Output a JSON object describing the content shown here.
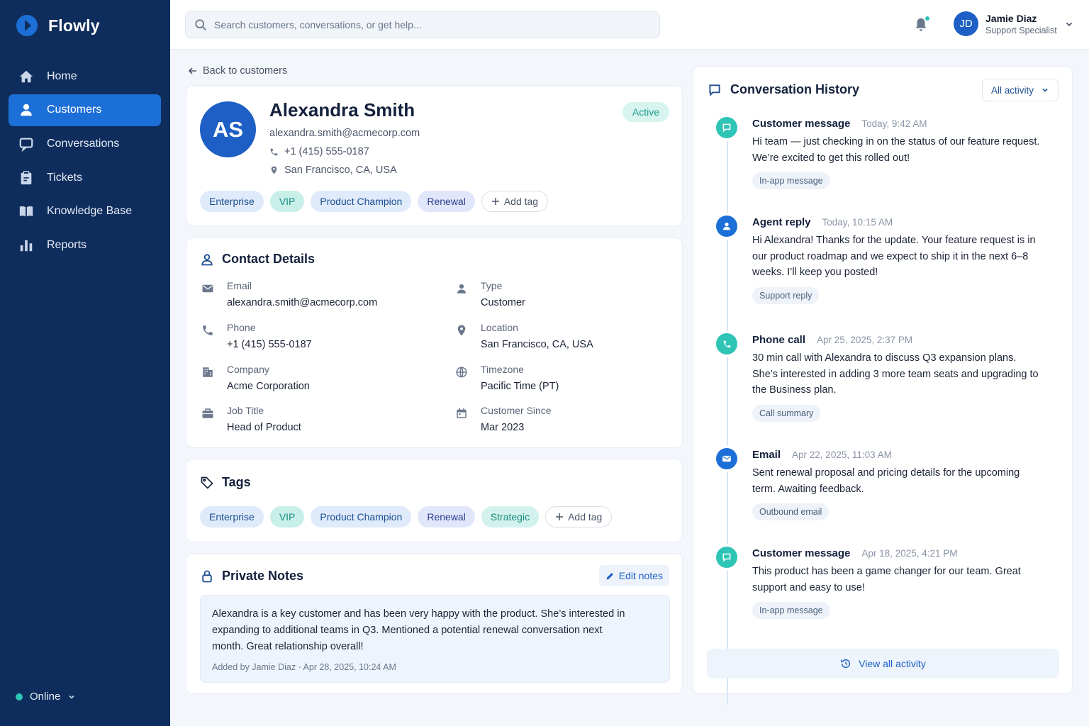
{
  "app": {
    "name": "Flowly",
    "accent": "#1d6fd8",
    "sidebar_bg": "#0f2d5c"
  },
  "sidebar": {
    "items": [
      {
        "label": "Home",
        "icon": "home-icon"
      },
      {
        "label": "Customers",
        "icon": "user-icon",
        "active": true
      },
      {
        "label": "Conversations",
        "icon": "chat-icon"
      },
      {
        "label": "Tickets",
        "icon": "clipboard-icon"
      },
      {
        "label": "Knowledge Base",
        "icon": "book-icon"
      },
      {
        "label": "Reports",
        "icon": "bar-chart-icon"
      }
    ],
    "status": "Online"
  },
  "header": {
    "search_placeholder": "Search customers, conversations, or get help...",
    "user": {
      "initials": "JD",
      "name": "Jamie Diaz",
      "role": "Support Specialist"
    }
  },
  "back_link": "Back to customers",
  "profile": {
    "initials": "AS",
    "name": "Alexandra Smith",
    "email": "alexandra.smith@acmecorp.com",
    "phone": "+1 (415) 555-0187",
    "location": "San Francisco, CA, USA",
    "status": "Active",
    "tags": [
      "Enterprise",
      "VIP",
      "Product Champion",
      "Renewal"
    ],
    "add_tag": "Add tag"
  },
  "contact": {
    "title": "Contact Details",
    "fields": [
      {
        "label": "Email",
        "value": "alexandra.smith@acmecorp.com",
        "icon": "mail-icon"
      },
      {
        "label": "Type",
        "value": "Customer",
        "icon": "person-icon"
      },
      {
        "label": "Phone",
        "value": "+1 (415) 555-0187",
        "icon": "phone-icon"
      },
      {
        "label": "Location",
        "value": "San Francisco, CA, USA",
        "icon": "pin-icon"
      },
      {
        "label": "Company",
        "value": "Acme Corporation",
        "icon": "building-icon"
      },
      {
        "label": "Timezone",
        "value": "Pacific Time (PT)",
        "icon": "globe-icon"
      },
      {
        "label": "Job Title",
        "value": "Head of Product",
        "icon": "briefcase-icon"
      },
      {
        "label": "Customer Since",
        "value": "Mar 2023",
        "icon": "calendar-icon"
      }
    ]
  },
  "tags_section": {
    "title": "Tags",
    "tags": [
      "Enterprise",
      "VIP",
      "Product Champion",
      "Renewal",
      "Strategic"
    ],
    "add_tag": "Add tag"
  },
  "notes": {
    "title": "Private Notes",
    "edit_label": "Edit notes",
    "text": "Alexandra is a key customer and has been very happy with the product. She’s interested in expanding to additional teams in Q3. Mentioned a potential renewal conversation next month. Great relationship overall!",
    "meta": "Added by Jamie Diaz · Apr 28, 2025, 10:24 AM"
  },
  "history": {
    "title": "Conversation History",
    "filter": "All activity",
    "events": [
      {
        "type": "Customer message",
        "time": "Today, 9:42 AM",
        "text": "Hi team — just checking in on the status of our feature request. We’re excited to get this rolled out!",
        "pill": "In-app message",
        "icon": "message-icon"
      },
      {
        "type": "Agent reply",
        "time": "Today, 10:15 AM",
        "text": "Hi Alexandra! Thanks for the update. Your feature request is in our product roadmap and we expect to ship it in the next 6–8 weeks. I’ll keep you posted!",
        "pill": "Support reply",
        "icon": "agent-icon"
      },
      {
        "type": "Phone call",
        "time": "Apr 25, 2025, 2:37 PM",
        "text": "30 min call with Alexandra to discuss Q3 expansion plans. She’s interested in adding 3 more team seats and upgrading to the Business plan.",
        "pill": "Call summary",
        "icon": "phone-icon"
      },
      {
        "type": "Email",
        "time": "Apr 22, 2025, 11:03 AM",
        "text": "Sent renewal proposal and pricing details for the upcoming term. Awaiting feedback.",
        "pill": "Outbound email",
        "icon": "mail-icon"
      },
      {
        "type": "Customer message",
        "time": "Apr 18, 2025, 4:21 PM",
        "text": "This product has been a game changer for our team. Great support and easy to use!",
        "pill": "In-app message",
        "icon": "message-icon"
      }
    ],
    "view_all": "View all activity"
  }
}
